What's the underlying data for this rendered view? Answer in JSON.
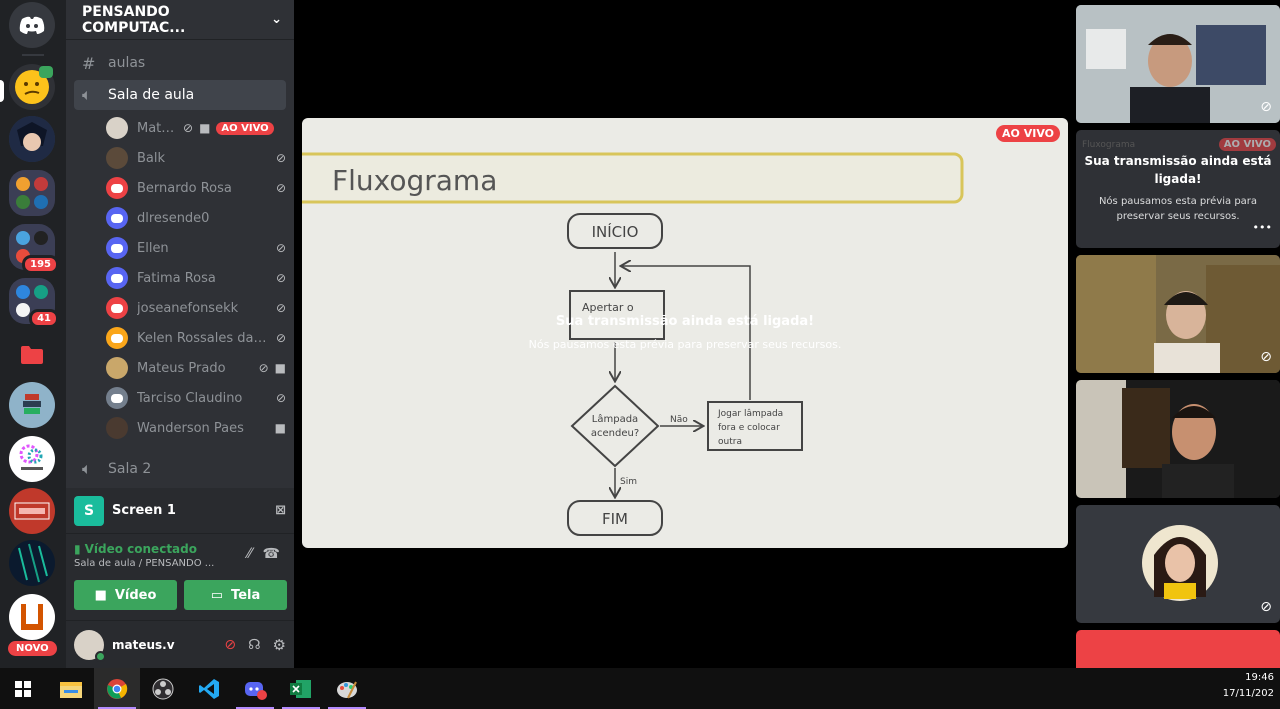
{
  "server": {
    "name": "PENSANDO COMPUTAC..."
  },
  "rail": {
    "badge_1": "195",
    "badge_2": "41",
    "new_label": "NOVO"
  },
  "channels": {
    "text": "aulas",
    "voice_active": "Sala de aula",
    "voice_2": "Sala 2"
  },
  "voice_users": [
    {
      "name": "Mate...",
      "live": "AO VIVO"
    },
    {
      "name": "Balk"
    },
    {
      "name": "Bernardo Rosa"
    },
    {
      "name": "dlresende0"
    },
    {
      "name": "Ellen"
    },
    {
      "name": "Fatima Rosa"
    },
    {
      "name": "joseanefonsekk"
    },
    {
      "name": "Kelen Rossales da S..."
    },
    {
      "name": "Mateus Prado"
    },
    {
      "name": "Tarciso Claudino"
    },
    {
      "name": "Wanderson Paes"
    }
  ],
  "screen": {
    "label": "Screen 1",
    "avatar_letter": "S"
  },
  "voice": {
    "status": "Vídeo conectado",
    "location": "Sala de aula / PENSANDO ...",
    "video_btn": "Vídeo",
    "screen_btn": "Tela"
  },
  "me": {
    "name": "mateus.v"
  },
  "stream": {
    "live_badge": "AO VIVO",
    "paused_title": "Sua transmissão ainda está ligada!",
    "paused_sub": "Nós pausamos esta prévia para preservar seus recursos.",
    "slide_title": "Fluxograma",
    "nodes": {
      "start": "INÍCIO",
      "press_line1": "Apertar o",
      "decision_line1": "Lâmpada",
      "decision_line2": "acendeu?",
      "action_line1": "Jogar lâmpada",
      "action_line2": "fora e colocar",
      "action_line3": "outra",
      "no": "Não",
      "yes": "Sim",
      "end": "FIM"
    }
  },
  "preview_tile": {
    "title": "Sua transmissão ainda está ligada!",
    "sub": "Nós pausamos esta prévia para preservar seus recursos.",
    "live_badge": "AO VIVO",
    "slide_title": "Fluxograma",
    "more": "•••"
  },
  "taskbar": {
    "time": "19:46",
    "date": "17/11/202"
  },
  "colors": {
    "accent": "#5865f2",
    "green": "#3ba55d",
    "red": "#ed4245"
  }
}
